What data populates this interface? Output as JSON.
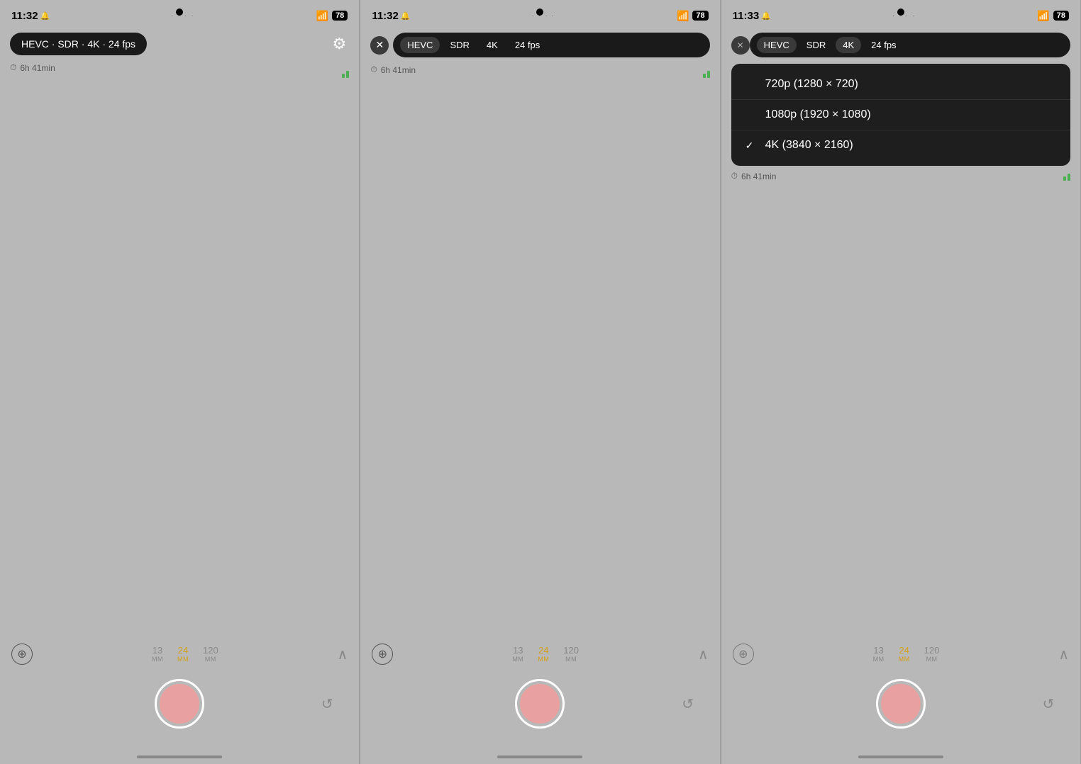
{
  "panels": [
    {
      "id": "panel1",
      "time": "11:32",
      "bell_icon": "🔔",
      "wifi": "📶",
      "battery": "78",
      "format_pill": "HEVC · SDR · 4K · 24 fps",
      "storage_duration": "6h 41min",
      "zoom_icon": "⊕",
      "focal_lengths": [
        {
          "num": "13",
          "label": "MM",
          "active": false
        },
        {
          "num": "24",
          "label": "MM",
          "active": true
        },
        {
          "num": "120",
          "label": "MM",
          "active": false
        }
      ],
      "record_visible": true,
      "settings_icon": "⚙"
    },
    {
      "id": "panel2",
      "time": "11:32",
      "bell_icon": "🔔",
      "wifi": "📶",
      "battery": "78",
      "bar_items": [
        "HEVC",
        "SDR",
        "4K",
        "24 fps"
      ],
      "storage_duration": "6h 41min",
      "zoom_icon": "⊕",
      "focal_lengths": [
        {
          "num": "13",
          "label": "MM",
          "active": false
        },
        {
          "num": "24",
          "label": "MM",
          "active": true
        },
        {
          "num": "120",
          "label": "MM",
          "active": false
        }
      ]
    },
    {
      "id": "panel3",
      "time": "11:33",
      "bell_icon": "🔔",
      "wifi": "📶",
      "battery": "78",
      "bar_items": [
        "HEVC",
        "SDR",
        "4K",
        "24 fps"
      ],
      "storage_duration": "6h 41min",
      "zoom_icon": "⊕",
      "focal_lengths": [
        {
          "num": "13",
          "label": "MM",
          "active": false
        },
        {
          "num": "24",
          "label": "MM",
          "active": true
        },
        {
          "num": "120",
          "label": "MM",
          "active": false
        }
      ],
      "resolution_options": [
        {
          "label": "720p (1280 × 720)",
          "checked": false
        },
        {
          "label": "1080p (1920 × 1080)",
          "checked": false
        },
        {
          "label": "4K (3840 × 2160)",
          "checked": true
        }
      ]
    }
  ],
  "labels": {
    "close_x": "✕",
    "up_arrow": "∧",
    "flip": "↺",
    "checkmark": "✓",
    "dots": "· · · ·"
  }
}
